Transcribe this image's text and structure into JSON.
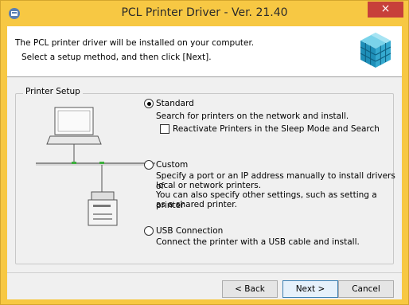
{
  "window": {
    "title": "PCL Printer Driver - Ver. 21.40",
    "close_glyph": "×",
    "accent_color": "#f7c843"
  },
  "header": {
    "line1": "The PCL printer driver will be installed on your computer.",
    "line2": "Select a setup method, and then click [Next].",
    "icon": "printer-driver-cube-icon"
  },
  "group": {
    "label": "Printer Setup"
  },
  "options": {
    "standard": {
      "label": "Standard",
      "selected": true,
      "description": "Search for printers on the network and install.",
      "reactivate_label": "Reactivate Printers in the Sleep Mode and Search",
      "reactivate_checked": false
    },
    "custom": {
      "label": "Custom",
      "selected": false,
      "description1": "Specify a port or an IP address manually to install drivers of",
      "description2": "local or network printers.",
      "description3": "You can also specify other settings, such as setting a printer",
      "description4": "as a shared printer."
    },
    "usb": {
      "label": "USB Connection",
      "selected": false,
      "description": "Connect the printer with a USB cable and install."
    }
  },
  "buttons": {
    "back": "< Back",
    "next": "Next >",
    "cancel": "Cancel"
  }
}
